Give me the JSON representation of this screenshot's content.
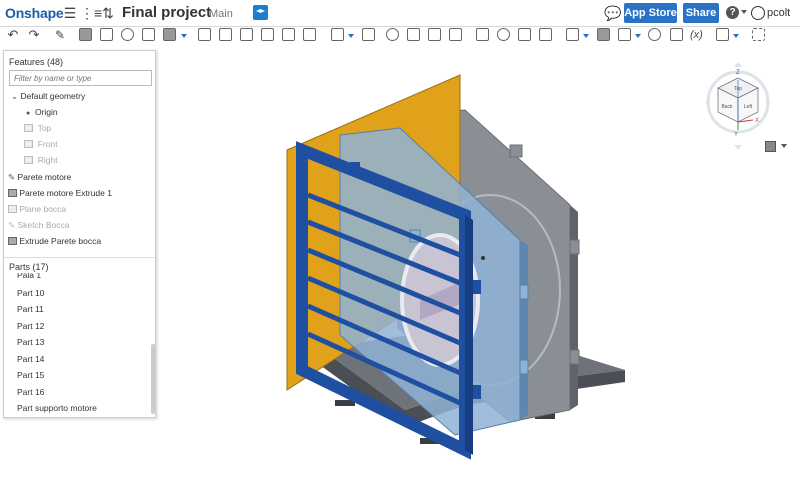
{
  "header": {
    "logo": "Onshape",
    "doc_title": "Final project",
    "branch": "Main",
    "app_store_label": "App Store",
    "share_label": "Share",
    "help": "?",
    "user": "pcolt"
  },
  "toolbar": {
    "variables_label": "(x)"
  },
  "features": {
    "header": "Features (48)",
    "filter_placeholder": "Filter by name or type",
    "items": [
      {
        "label": "Default geometry"
      },
      {
        "label": "Origin"
      },
      {
        "label": "Top"
      },
      {
        "label": "Front"
      },
      {
        "label": "Right"
      },
      {
        "label": "Parete motore"
      },
      {
        "label": "Parete motore Extrude 1"
      },
      {
        "label": "Plane bocca"
      },
      {
        "label": "Sketch Bocca"
      },
      {
        "label": "Extrude Parete bocca"
      }
    ]
  },
  "parts": {
    "header": "Parts (17)",
    "items": [
      {
        "label": "Pala 1"
      },
      {
        "label": "Part 10"
      },
      {
        "label": "Part 11"
      },
      {
        "label": "Part 12"
      },
      {
        "label": "Part 13"
      },
      {
        "label": "Part 14"
      },
      {
        "label": "Part 15"
      },
      {
        "label": "Part 16"
      },
      {
        "label": "Part supporto motore"
      }
    ]
  },
  "view_cube": {
    "top": "Top",
    "back": "Back",
    "left": "Left",
    "axis_x": "X",
    "axis_y": "Y",
    "axis_z": "Z"
  },
  "colors": {
    "brand": "#1a5fa8",
    "button": "#2a72c6",
    "base_plate": "#6e7379",
    "motor_wall": "#8a8f96",
    "glass_panel": "#8fb3d6",
    "front_frame": "#1f4fa0",
    "back_wall": "#e0a11b"
  }
}
